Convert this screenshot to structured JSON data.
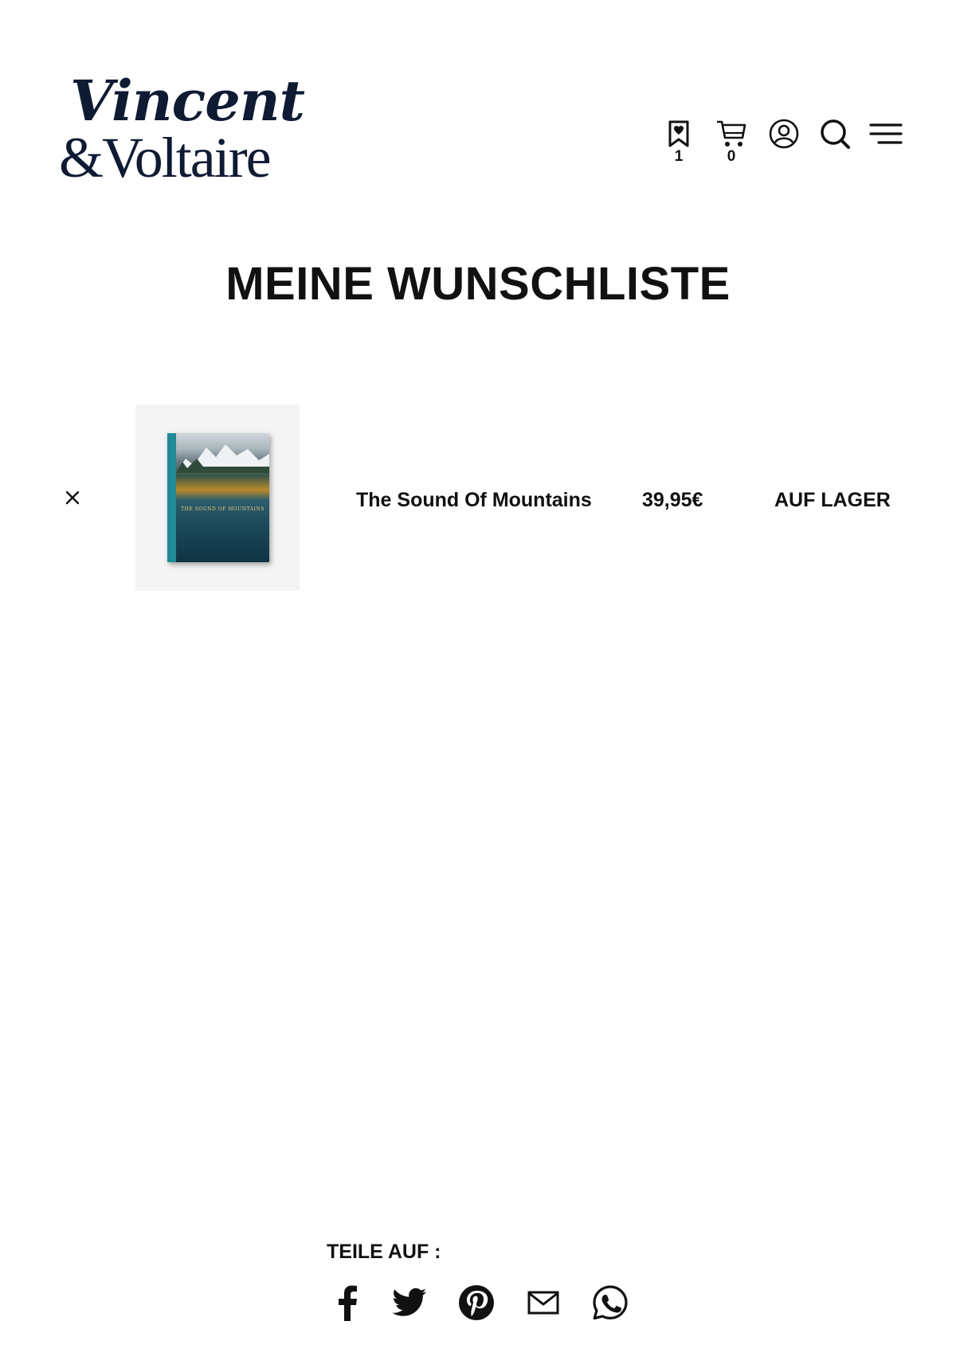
{
  "brand": {
    "line1": "Vincent",
    "line2": "&Voltaire",
    "color": "#0f1a33"
  },
  "header": {
    "wishlist_count": "1",
    "cart_count": "0",
    "icons": [
      "bookmark-heart-icon",
      "cart-icon",
      "user-icon",
      "search-icon",
      "menu-icon"
    ]
  },
  "page": {
    "title": "MEINE WUNSCHLISTE"
  },
  "wishlist": {
    "items": [
      {
        "name": "The Sound Of Mountains",
        "price": "39,95€",
        "stock": "AUF LAGER",
        "cover_title": "THE SOUND OF MOUNTAINS"
      }
    ]
  },
  "share": {
    "label": "TEILE AUF :",
    "icons": [
      "facebook-icon",
      "twitter-icon",
      "pinterest-icon",
      "mail-icon",
      "whatsapp-icon"
    ]
  }
}
